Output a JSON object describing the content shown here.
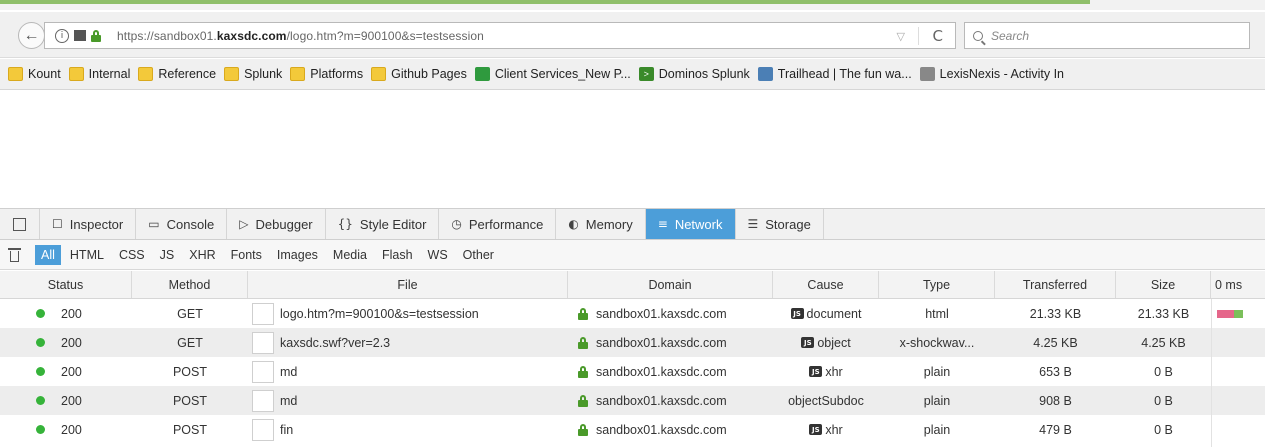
{
  "browser": {
    "url_prefix": "https://sandbox01.",
    "url_host": "kaxsdc.com",
    "url_suffix": "/logo.htm?m=900100&s=testsession",
    "search_placeholder": "Search",
    "info_glyph": "i",
    "reload_glyph": "C",
    "dropdown_glyph": "▽",
    "back_glyph": "←"
  },
  "bookmarks": [
    {
      "label": "Kount",
      "icon": "folder-icon"
    },
    {
      "label": "Internal",
      "icon": "folder-icon"
    },
    {
      "label": "Reference",
      "icon": "folder-icon"
    },
    {
      "label": "Splunk",
      "icon": "folder-icon"
    },
    {
      "label": "Platforms",
      "icon": "folder-icon"
    },
    {
      "label": "Github Pages",
      "icon": "folder-icon"
    },
    {
      "label": "Client Services_New P...",
      "icon": "sheet-icon"
    },
    {
      "label": "Dominos Splunk",
      "icon": "dominos-icon"
    },
    {
      "label": "Trailhead | The fun wa...",
      "icon": "trail-icon"
    },
    {
      "label": "LexisNexis - Activity In",
      "icon": "globe-icon"
    }
  ],
  "devtools": {
    "tabs": [
      {
        "label": "Inspector",
        "glyph": "☐",
        "icon": "inspector-icon",
        "active": false
      },
      {
        "label": "Console",
        "glyph": "▭",
        "icon": "console-icon",
        "active": false
      },
      {
        "label": "Debugger",
        "glyph": "▷",
        "icon": "debugger-icon",
        "active": false
      },
      {
        "label": "Style Editor",
        "glyph": "{}",
        "icon": "style-editor-icon",
        "active": false
      },
      {
        "label": "Performance",
        "glyph": "◷",
        "icon": "performance-icon",
        "active": false
      },
      {
        "label": "Memory",
        "glyph": "◐",
        "icon": "memory-icon",
        "active": false
      },
      {
        "label": "Network",
        "glyph": "≡",
        "icon": "network-icon",
        "active": true
      },
      {
        "label": "Storage",
        "glyph": "☰",
        "icon": "storage-icon",
        "active": false
      }
    ],
    "filters": [
      "All",
      "HTML",
      "CSS",
      "JS",
      "XHR",
      "Fonts",
      "Images",
      "Media",
      "Flash",
      "WS",
      "Other"
    ],
    "active_filter": "All"
  },
  "network": {
    "columns": {
      "status": "Status",
      "method": "Method",
      "file": "File",
      "domain": "Domain",
      "cause": "Cause",
      "type": "Type",
      "transferred": "Transferred",
      "size": "Size",
      "waterfall": "0 ms"
    },
    "rows": [
      {
        "status": "200",
        "method": "GET",
        "file": "logo.htm?m=900100&s=testsession",
        "domain": "sandbox01.kaxsdc.com",
        "cause": "document",
        "cause_badge": "JS",
        "type": "html",
        "transferred": "21.33 KB",
        "size": "21.33 KB",
        "waterfall": true
      },
      {
        "status": "200",
        "method": "GET",
        "file": "kaxsdc.swf?ver=2.3",
        "domain": "sandbox01.kaxsdc.com",
        "cause": "object",
        "cause_badge": "JS",
        "type": "x-shockwav...",
        "transferred": "4.25 KB",
        "size": "4.25 KB",
        "waterfall": false
      },
      {
        "status": "200",
        "method": "POST",
        "file": "md",
        "domain": "sandbox01.kaxsdc.com",
        "cause": "xhr",
        "cause_badge": "JS",
        "type": "plain",
        "transferred": "653 B",
        "size": "0 B",
        "waterfall": false
      },
      {
        "status": "200",
        "method": "POST",
        "file": "md",
        "domain": "sandbox01.kaxsdc.com",
        "cause": "objectSubdoc",
        "cause_badge": "",
        "type": "plain",
        "transferred": "908 B",
        "size": "0 B",
        "waterfall": false
      },
      {
        "status": "200",
        "method": "POST",
        "file": "fin",
        "domain": "sandbox01.kaxsdc.com",
        "cause": "xhr",
        "cause_badge": "JS",
        "type": "plain",
        "transferred": "479 B",
        "size": "0 B",
        "waterfall": false
      }
    ]
  }
}
